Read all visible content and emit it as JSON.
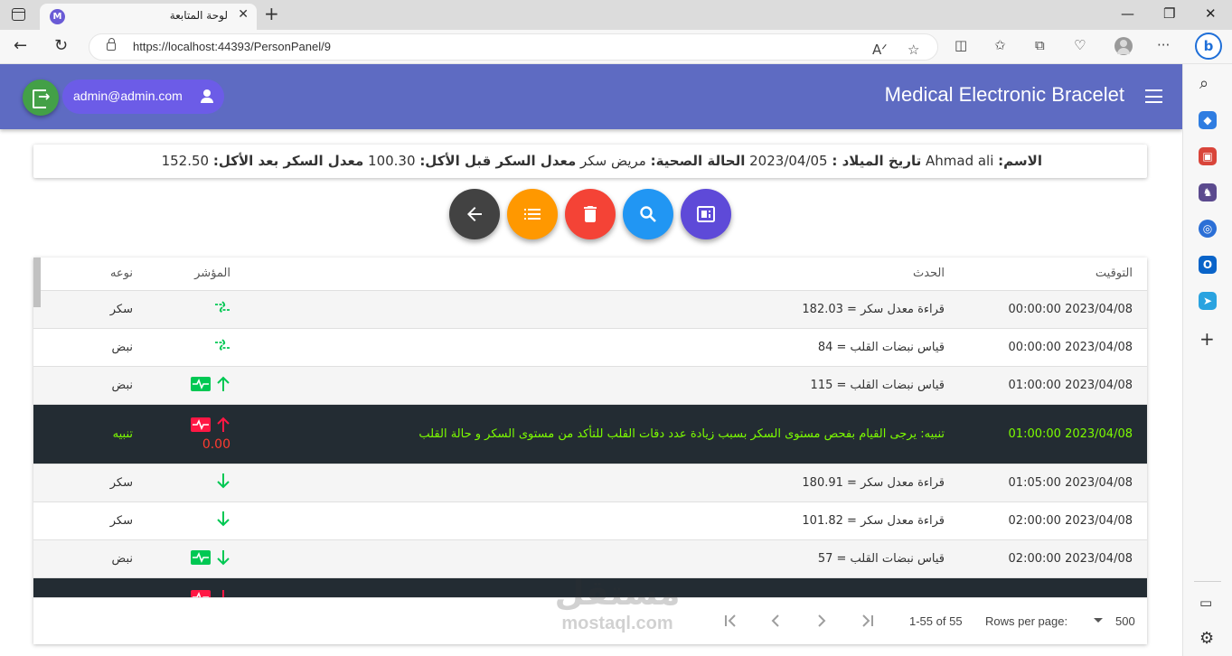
{
  "browser": {
    "tab_title": "لوحة المتابعة",
    "favicon_letter": "M",
    "url": "https://localhost:44393/PersonPanel/9"
  },
  "header": {
    "title": "Medical Electronic Bracelet",
    "user_email": "admin@admin.com"
  },
  "patient": {
    "name_label": "الاسم:",
    "name": "Ahmad ali",
    "dob_label": "تاريخ الميلاد :",
    "dob": "2023/04/05",
    "status_label": "الحالة الصحية:",
    "status": "مريض سكر",
    "before_label": "معدل السكر قبل الأكل:",
    "before": "100.30",
    "after_label": "معدل السكر بعد الأكل:",
    "after": "152.50"
  },
  "actions": [
    {
      "name": "back",
      "color": "#424242",
      "icon": "arrow-left-icon"
    },
    {
      "name": "list",
      "color": "#ff9800",
      "icon": "list-icon"
    },
    {
      "name": "delete",
      "color": "#f44336",
      "icon": "trash-icon"
    },
    {
      "name": "search",
      "color": "#2196f3",
      "icon": "search-icon"
    },
    {
      "name": "report",
      "color": "#5e4ad8",
      "icon": "report-icon"
    }
  ],
  "table": {
    "headers": {
      "time": "التوقيت",
      "event": "الحدث",
      "indicator": "المؤشر",
      "type": "نوعه"
    },
    "rows": [
      {
        "time": "2023/04/08 00:00:00",
        "event": "قراءة معدل سكر = 182.03",
        "indicator": "swap",
        "type": "سكر",
        "alert": false
      },
      {
        "time": "2023/04/08 00:00:00",
        "event": "قياس نبضات القلب = 84",
        "indicator": "swap",
        "type": "نبض",
        "alert": false
      },
      {
        "time": "2023/04/08 01:00:00",
        "event": "قياس نبضات القلب = 115",
        "indicator": "pulse-up",
        "type": "نبض",
        "alert": false
      },
      {
        "time": "2023/04/08 01:00:00",
        "event": "تنبيه: يرجى القيام بفحص مستوى السكر بسبب زيادة عدد دقات القلب للتأكد من مستوى السكر و حالة القلب",
        "indicator": "alert-up",
        "value": "0.00",
        "type": "تنبيه",
        "alert": true
      },
      {
        "time": "2023/04/08 01:05:00",
        "event": "قراءة معدل سكر = 180.91",
        "indicator": "down",
        "type": "سكر",
        "alert": false
      },
      {
        "time": "2023/04/08 02:00:00",
        "event": "قراءة معدل سكر = 101.82",
        "indicator": "down",
        "type": "سكر",
        "alert": false
      },
      {
        "time": "2023/04/08 02:00:00",
        "event": "قياس نبضات القلب = 57",
        "indicator": "pulse-down",
        "type": "نبض",
        "alert": false
      },
      {
        "time": "",
        "event": "",
        "indicator": "alert-down",
        "type": "",
        "alert": true
      }
    ]
  },
  "pagination": {
    "rows_per_page_label": "Rows per page:",
    "rows_per_page": "500",
    "range": "1-55 of 55"
  },
  "watermark": {
    "arabic": "مستقل",
    "latin": "mostaql.com"
  },
  "colors": {
    "header": "#5e6bc2",
    "positive": "#00c853",
    "alert": "#ff1744",
    "alert_row": "#232c33",
    "alert_text": "#7cfc00"
  }
}
